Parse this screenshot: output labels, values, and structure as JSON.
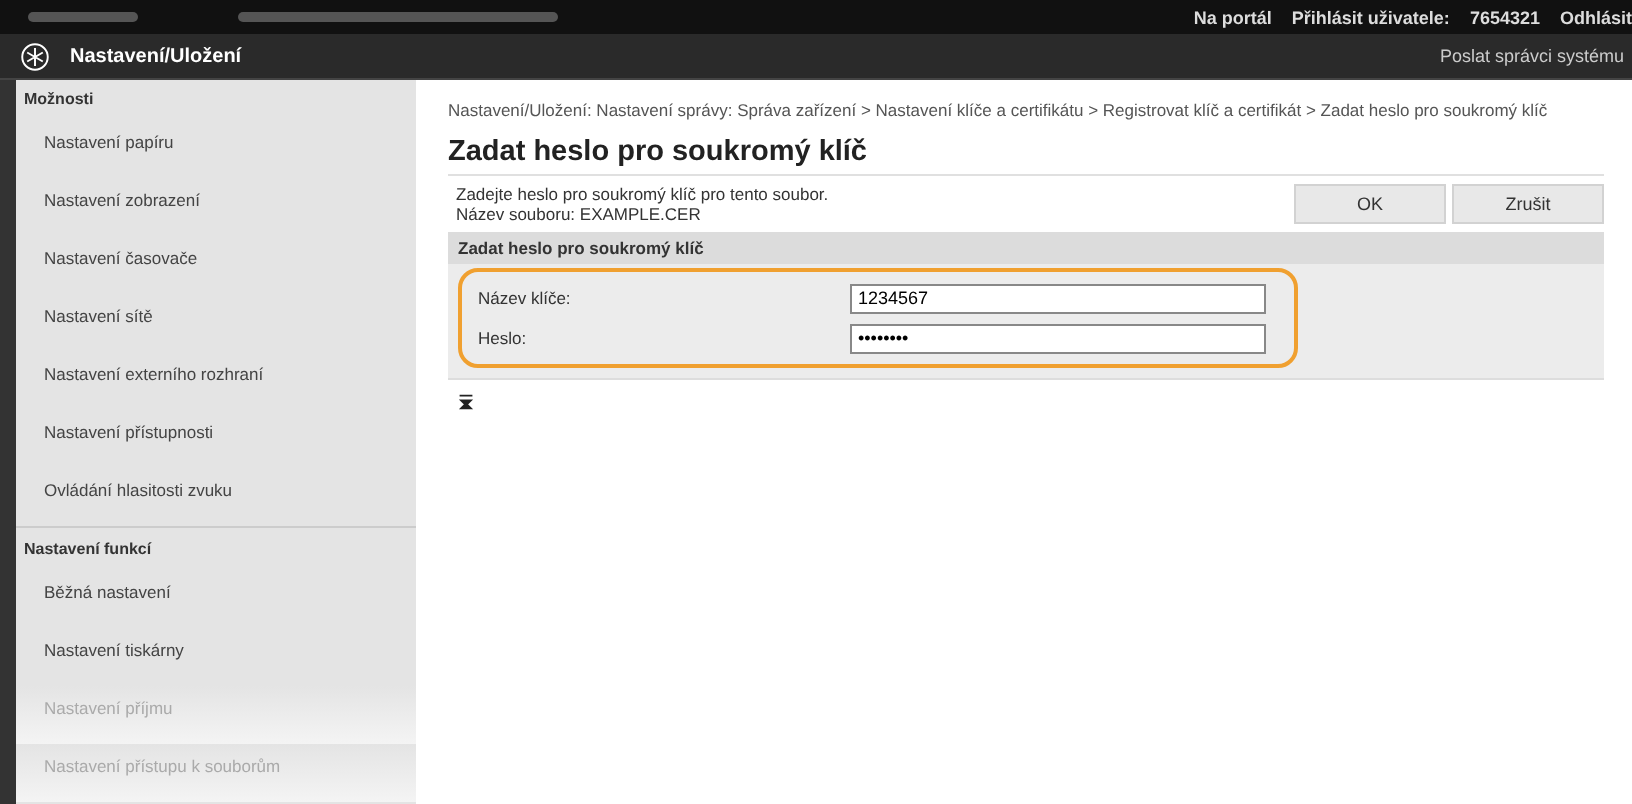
{
  "top_bar": {
    "links": [
      "Na portál",
      "Přihlásit uživatele:",
      "7654321",
      "Odhlásit"
    ]
  },
  "header": {
    "title": "Nastavení/Uložení",
    "right_link": "Poslat správci systému"
  },
  "sidebar": {
    "sections": [
      {
        "heading": "Možnosti",
        "items": [
          {
            "label": "Nastavení papíru",
            "faded": false
          },
          {
            "label": "Nastavení zobrazení",
            "faded": false
          },
          {
            "label": "Nastavení časovače",
            "faded": false
          },
          {
            "label": "Nastavení sítě",
            "faded": false
          },
          {
            "label": "Nastavení externího rozhraní",
            "faded": false
          },
          {
            "label": "Nastavení přístupnosti",
            "faded": false
          },
          {
            "label": "Ovládání hlasitosti zvuku",
            "faded": false
          }
        ]
      },
      {
        "heading": "Nastavení funkcí",
        "items": [
          {
            "label": "Běžná nastavení",
            "faded": false
          },
          {
            "label": "Nastavení tiskárny",
            "faded": false
          },
          {
            "label": "Nastavení příjmu",
            "faded": true
          },
          {
            "label": "Nastavení přístupu k souborům",
            "faded": true
          }
        ]
      }
    ]
  },
  "breadcrumb": "Nastavení/Uložení: Nastavení správy: Správa zařízení > Nastavení klíče a certifikátu > Registrovat klíč a certifikát > Zadat heslo pro soukromý klíč",
  "page_title": "Zadat heslo pro soukromý klíč",
  "instructions": [
    "Zadejte heslo pro soukromý klíč pro tento soubor.",
    "Název souboru: EXAMPLE.CER"
  ],
  "buttons": [
    "OK",
    "Zrušit"
  ],
  "form": {
    "heading": "Zadat heslo pro soukromý klíč",
    "fields": [
      {
        "label": "Název klíče:",
        "value": "1234567"
      },
      {
        "label": "Heslo:",
        "value": "••••••••"
      }
    ],
    "highlighted": true
  }
}
